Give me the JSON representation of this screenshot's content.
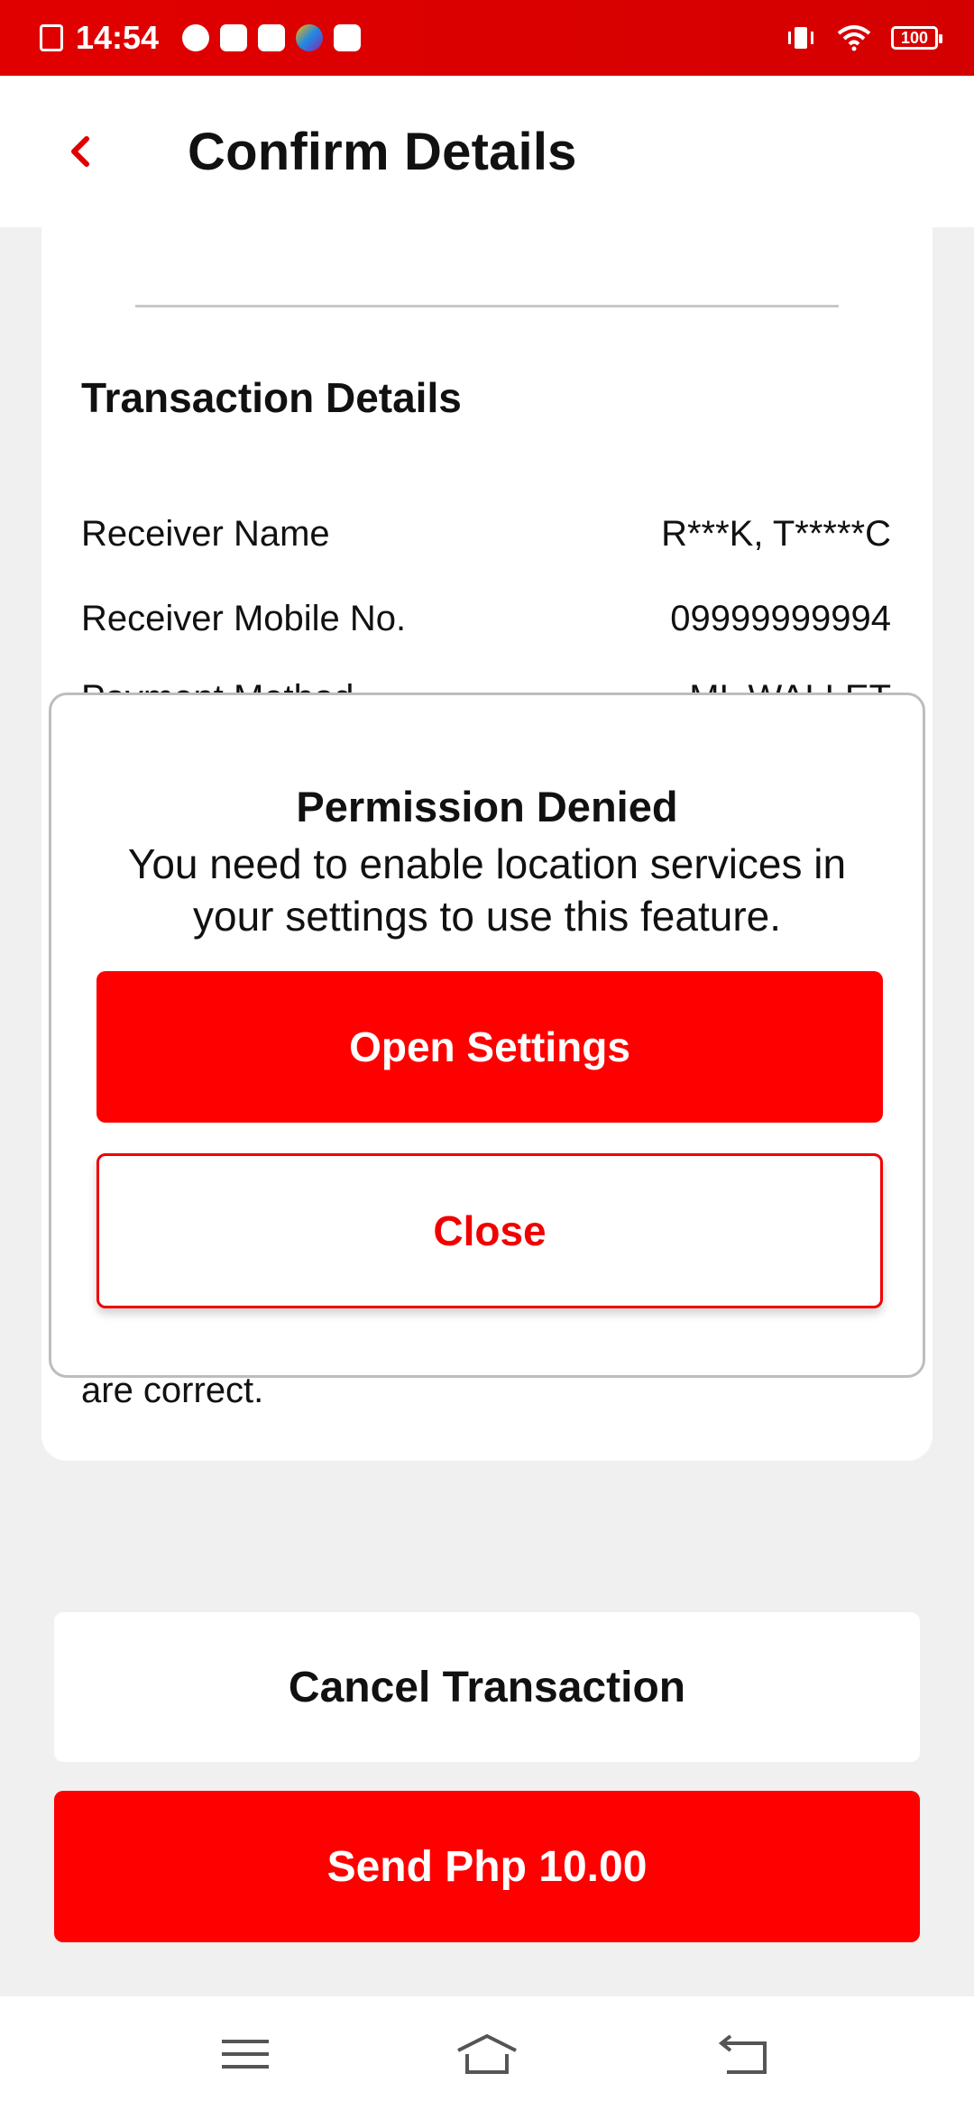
{
  "status_bar": {
    "time": "14:54",
    "battery": "100",
    "left_icons": [
      "sim-alert-icon",
      "speedometer-icon",
      "mail-icon",
      "mail-icon",
      "browser-icon",
      "gift-icon"
    ],
    "right_icons": [
      "vibrate-icon",
      "wifi-icon",
      "battery-icon"
    ]
  },
  "header": {
    "title": "Confirm Details",
    "back_icon": "chevron-left-icon"
  },
  "transaction": {
    "section_title": "Transaction Details",
    "rows": [
      {
        "label": "Receiver Name",
        "value": "R***K, T*****C"
      },
      {
        "label": "Receiver Mobile No.",
        "value": "09999999994"
      },
      {
        "label": "Payment Method",
        "value": "ML WALLET"
      }
    ],
    "footnote": "are correct."
  },
  "dialog": {
    "title": "Permission Denied",
    "message": "You need to enable location services in your settings to use this feature.",
    "primary_label": "Open Settings",
    "secondary_label": "Close"
  },
  "actions": {
    "cancel_label": "Cancel Transaction",
    "send_label": "Send Php 10.00"
  },
  "nav": {
    "icons": [
      "menu-icon",
      "home-icon",
      "back-icon"
    ]
  },
  "colors": {
    "accent": "#ff0000",
    "status_bar": "#e10000",
    "background": "#f0f0f0"
  }
}
